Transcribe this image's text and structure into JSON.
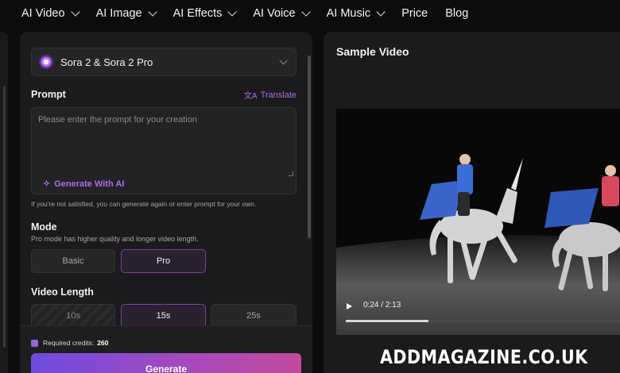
{
  "nav": {
    "items": [
      {
        "label": "AI Video",
        "dropdown": true
      },
      {
        "label": "AI Image",
        "dropdown": true
      },
      {
        "label": "AI Effects",
        "dropdown": true
      },
      {
        "label": "AI Voice",
        "dropdown": true
      },
      {
        "label": "AI Music",
        "dropdown": true
      },
      {
        "label": "Price",
        "dropdown": false
      },
      {
        "label": "Blog",
        "dropdown": false
      }
    ]
  },
  "form": {
    "model": {
      "selected": "Sora 2 & Sora 2 Pro",
      "icon": "openai-logo-icon"
    },
    "prompt": {
      "label": "Prompt",
      "translate_label": "Translate",
      "placeholder": "Please enter the prompt for your creation",
      "generate_ai_label": "Generate With AI",
      "hint": "If you're not satisfied, you can generate again or enter prompt for your own."
    },
    "mode": {
      "label": "Mode",
      "description": "Pro mode has higher quality and longer video length.",
      "options": [
        {
          "label": "Basic",
          "selected": false
        },
        {
          "label": "Pro",
          "selected": true
        }
      ]
    },
    "video_length": {
      "label": "Video Length",
      "options": [
        {
          "label": "10s",
          "selected": false,
          "disabled": true
        },
        {
          "label": "15s",
          "selected": true,
          "disabled": false
        },
        {
          "label": "25s",
          "selected": false,
          "disabled": false
        }
      ]
    },
    "credits": {
      "label": "Required credits:",
      "value": "260"
    },
    "generate_label": "Generate"
  },
  "sample": {
    "title": "Sample Video",
    "time": "0:24 / 2:13",
    "progress_fraction": 0.3
  },
  "watermark": "ADDMAGAZINE.CO.UK",
  "colors": {
    "accent": "#b06ee8",
    "panel": "#1b1b1e",
    "background": "#0c0c0e"
  }
}
